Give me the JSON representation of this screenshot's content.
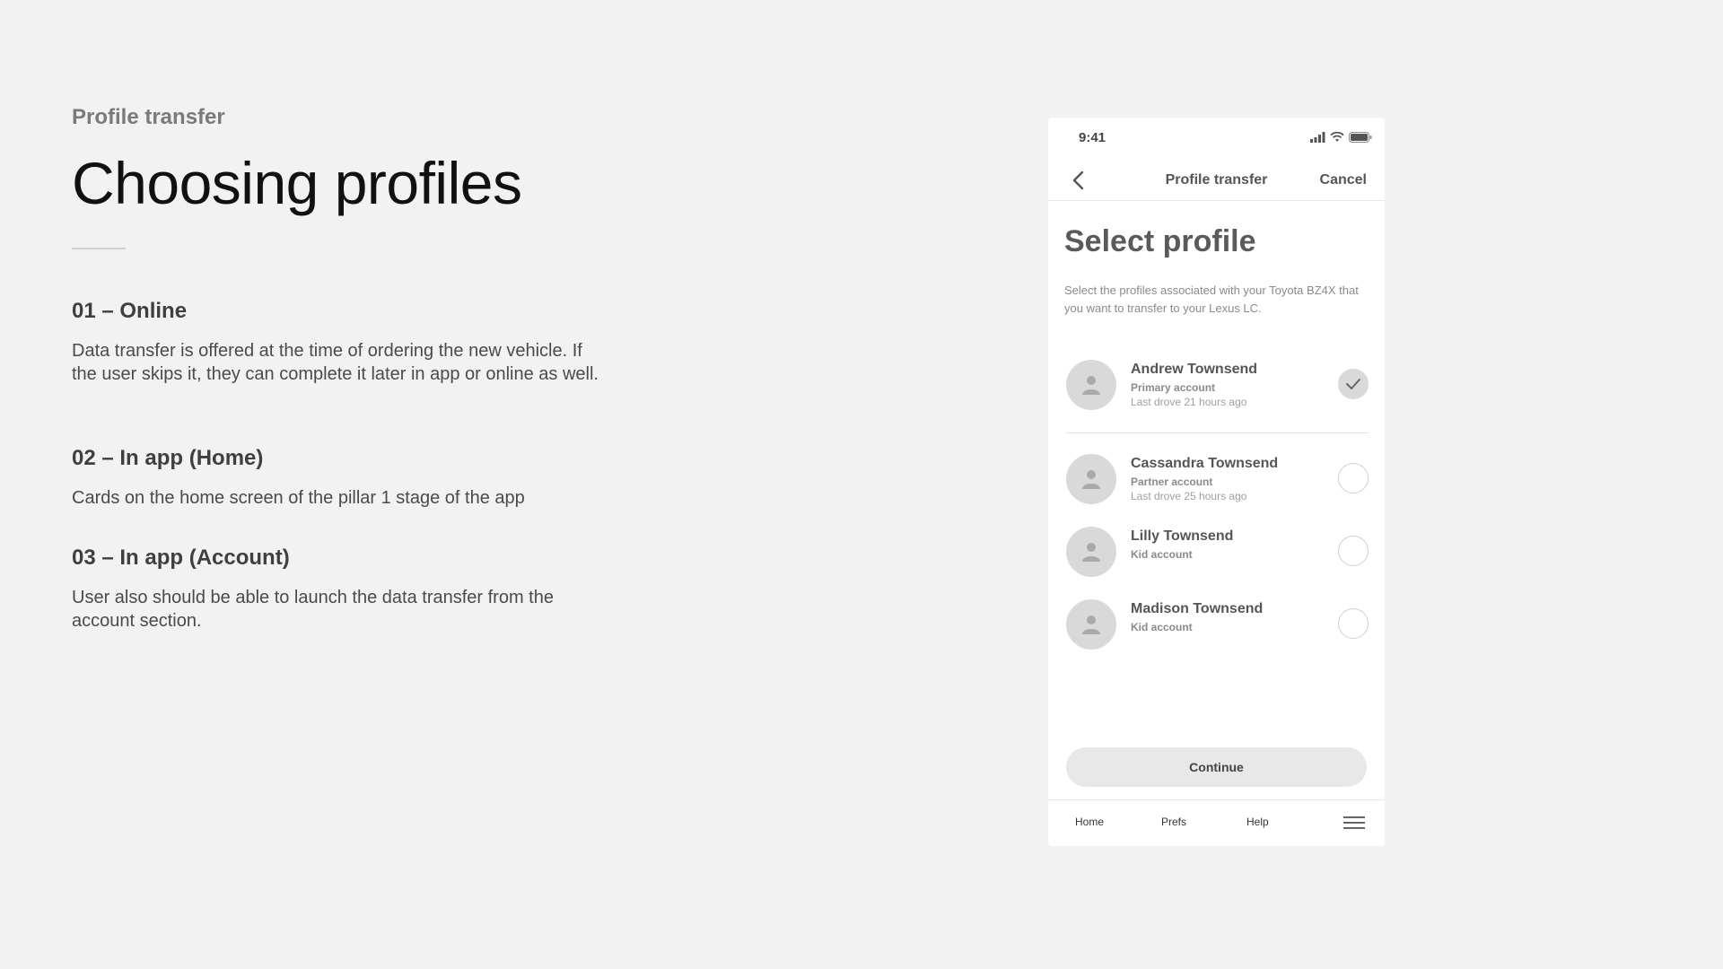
{
  "left": {
    "eyebrow": "Profile transfer",
    "title": "Choosing profiles",
    "sections": [
      {
        "heading": "01 – Online",
        "body": "Data transfer is offered at the time of ordering the new vehicle. If the user skips it, they can complete it later in app or online as well."
      },
      {
        "heading": "02 – In app (Home)",
        "body": "Cards on the home screen of the pillar 1 stage of the app"
      },
      {
        "heading": "03 – In app (Account)",
        "body": "User also should be able to launch the data transfer from the account section."
      }
    ]
  },
  "phone": {
    "status": {
      "time": "9:41"
    },
    "nav": {
      "title": "Profile transfer",
      "cancel": "Cancel"
    },
    "heading": "Select profile",
    "description": "Select the profiles associated with your Toyota BZ4X that you want to transfer to your Lexus LC.",
    "profiles": [
      {
        "name": "Andrew Townsend",
        "type": "Primary account",
        "last": "Last drove 21 hours ago",
        "selected": true
      },
      {
        "name": "Cassandra Townsend",
        "type": "Partner account",
        "last": "Last drove 25 hours ago",
        "selected": false
      },
      {
        "name": "Lilly Townsend",
        "type": "Kid account",
        "last": "",
        "selected": false
      },
      {
        "name": "Madison Townsend",
        "type": "Kid account",
        "last": "",
        "selected": false
      }
    ],
    "continue_label": "Continue",
    "tabs": {
      "home": "Home",
      "prefs": "Prefs",
      "help": "Help"
    }
  },
  "colors": {
    "background": "#f2f2f2",
    "card": "#ffffff",
    "avatar": "#d9d9d9",
    "button": "#e8e8e8"
  }
}
